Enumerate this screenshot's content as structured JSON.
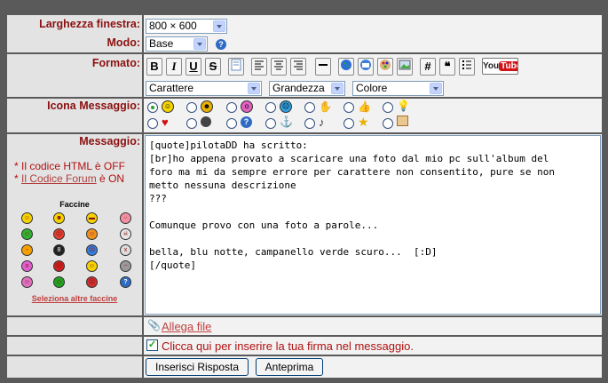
{
  "rows": {
    "window_width": {
      "label": "Larghezza finestra:",
      "value": "800 × 600"
    },
    "mode": {
      "label": "Modo:",
      "value": "Base",
      "help": "?"
    },
    "format": {
      "label": "Formato:",
      "buttons": [
        "B",
        "I",
        "U",
        "S"
      ],
      "youtube": "YouTube",
      "font_select": "Carattere",
      "size_select": "Grandezza",
      "color_select": "Colore"
    },
    "icon": {
      "label": "Icona Messaggio:"
    },
    "message": {
      "label": "Messaggio:",
      "html_note_prefix": "* Il codice HTML è ",
      "html_state": "OFF",
      "forum_link": "Il Codice Forum",
      "forum_note_mid": " è ",
      "forum_state": "ON",
      "smileys_title": "Faccine",
      "more_smileys": "Seleziona altre faccine",
      "text": "[quote]pilotaDD ha scritto:\n[br]ho appena provato a scaricare una foto dal mio pc sull'album del\nforo ma mi da sempre errore per carattere non consentito, pure se non\nmetto nessuna descrizione\n???\n\nComunque provo con una foto a parole...\n\nbella, blu notte, campanello verde scuro...  [:D]\n[/quote]"
    },
    "attach": {
      "label": "Allega file"
    },
    "signature": {
      "label": "Clicca qui per inserire la tua firma nel messaggio."
    },
    "actions": {
      "reply": "Inserisci Risposta",
      "preview": "Anteprima"
    }
  },
  "colors": {
    "label": "#8b1010",
    "accent": "#7f9db9"
  },
  "icons": [
    "smile-icon",
    "sun-icon",
    "teeth-icon",
    "shock-icon",
    "sad-icon",
    "thumb-down-icon",
    "thumb-up-icon",
    "bulb-icon",
    "heart-icon",
    "bomb-icon",
    "question-icon",
    "anchor-icon",
    "music-icon",
    "star-icon",
    "cake-icon",
    "paperclip-icon"
  ]
}
